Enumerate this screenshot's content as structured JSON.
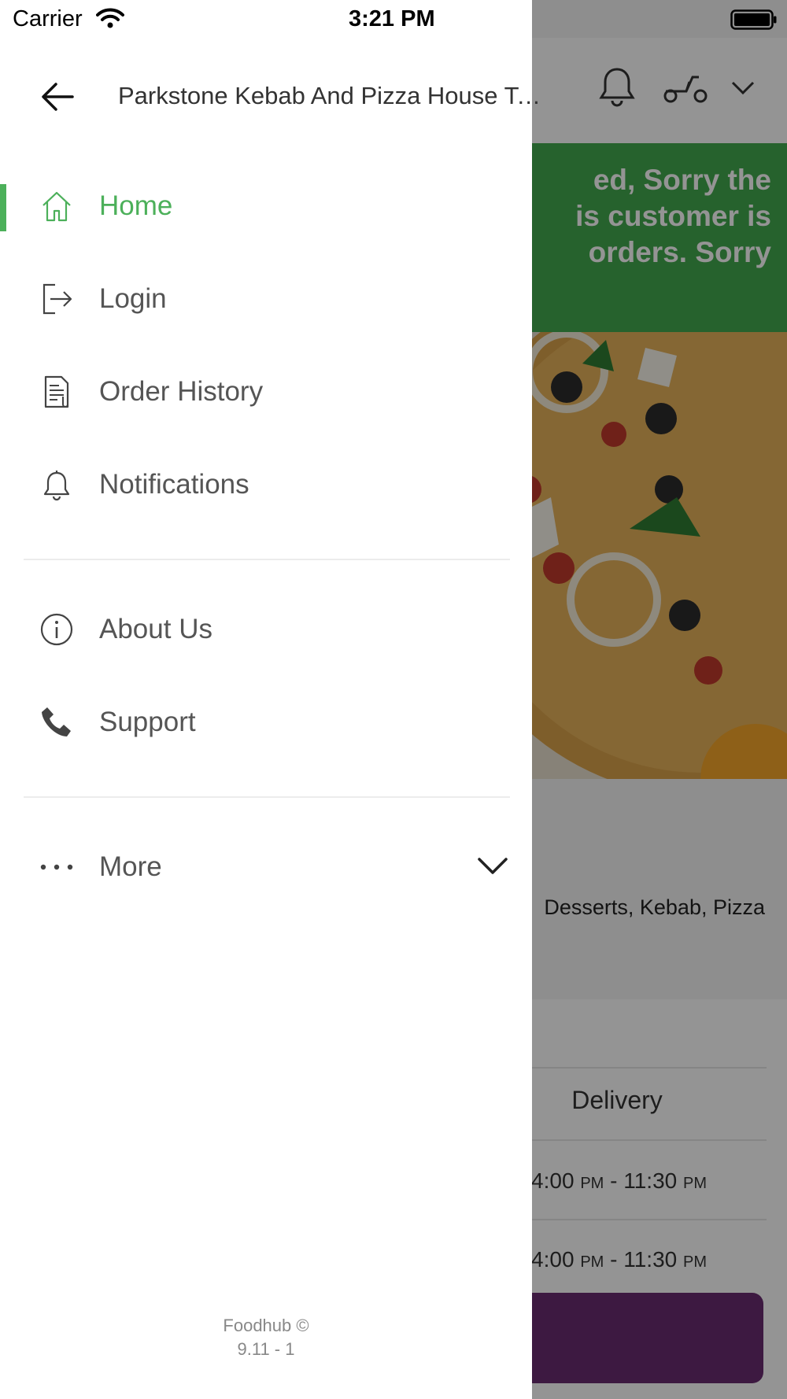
{
  "status_bar": {
    "carrier": "Carrier",
    "time": "3:21 PM"
  },
  "drawer": {
    "title": "Parkstone Kebab And Pizza House Take Away",
    "menu": [
      {
        "label": "Home",
        "icon": "home-icon",
        "active": true
      },
      {
        "label": "Login",
        "icon": "login-icon"
      },
      {
        "label": "Order History",
        "icon": "order-history-icon"
      },
      {
        "label": "Notifications",
        "icon": "bell-icon"
      },
      {
        "label": "About Us",
        "icon": "info-icon"
      },
      {
        "label": "Support",
        "icon": "phone-icon"
      },
      {
        "label": "More",
        "icon": "more-icon"
      }
    ],
    "footer_brand": "Foodhub ©",
    "footer_version": "9.11 - 1",
    "accent_color": "#4cb05a"
  },
  "background": {
    "banner_text": "ed, Sorry the\nis customer is\norders. Sorry",
    "cuisines": "Desserts, Kebab, Pizza",
    "table_header": "Delivery",
    "rows": [
      {
        "time": "04:00",
        "ampm1": "PM",
        "sep": " - 11:30 ",
        "ampm2": "PM"
      },
      {
        "time": "04:00",
        "ampm1": "PM",
        "sep": " - 11:30 ",
        "ampm2": "PM"
      }
    ]
  }
}
